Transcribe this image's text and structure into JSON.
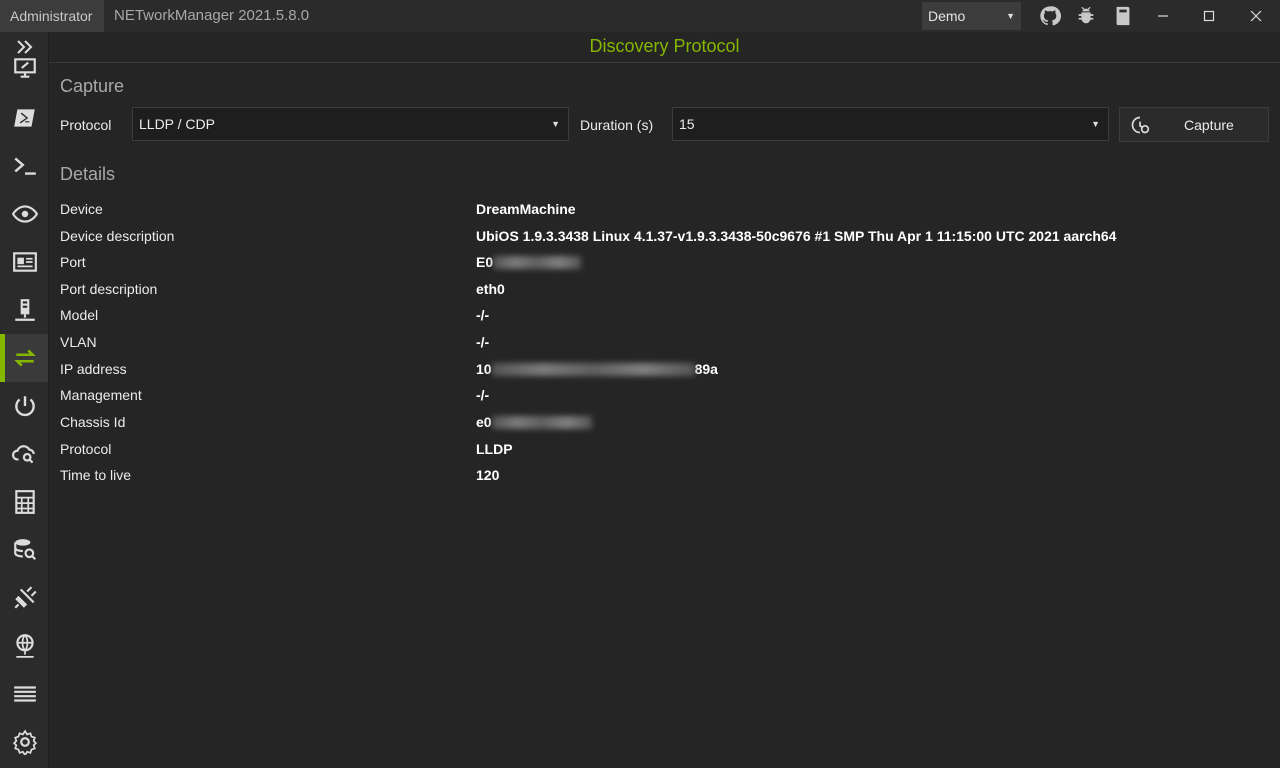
{
  "titlebar": {
    "admin_badge": "Administrator",
    "app_title": "NETworkManager 2021.5.8.0",
    "profile": "Demo"
  },
  "header": {
    "title": "Discovery Protocol"
  },
  "capture": {
    "section_title": "Capture",
    "protocol_label": "Protocol",
    "protocol_value": "LLDP / CDP",
    "duration_label": "Duration (s)",
    "duration_value": "15",
    "button_label": "Capture"
  },
  "details": {
    "section_title": "Details",
    "rows": [
      {
        "label": "Device",
        "value": "DreamMachine"
      },
      {
        "label": "Device description",
        "value": "UbiOS 1.9.3.3438 Linux 4.1.37-v1.9.3.3438-50c9676 #1 SMP Thu Apr 1 11:15:00 UTC 2021 aarch64"
      },
      {
        "label": "Port",
        "value": "E0"
      },
      {
        "label": "Port description",
        "value": "eth0"
      },
      {
        "label": "Model",
        "value": "-/-"
      },
      {
        "label": "VLAN",
        "value": "-/-"
      },
      {
        "label": "IP address",
        "value": "10",
        "value_suffix": "89a"
      },
      {
        "label": "Management",
        "value": "-/-"
      },
      {
        "label": "Chassis Id",
        "value": "e0"
      },
      {
        "label": "Protocol",
        "value": "LLDP"
      },
      {
        "label": "Time to live",
        "value": "120"
      }
    ]
  },
  "theme": {
    "accent": "#85b700",
    "background": "#252525",
    "panel": "#2b2b2b"
  },
  "icons": [
    "expand-icon",
    "remote-desktop-icon",
    "powershell-icon",
    "terminal-icon",
    "eye-icon",
    "dashboard-icon",
    "network-device-icon",
    "discovery-protocol-icon",
    "power-icon",
    "cloud-search-icon",
    "calculator-icon",
    "database-search-icon",
    "plug-icon",
    "globe-icon",
    "list-icon",
    "gear-icon"
  ]
}
